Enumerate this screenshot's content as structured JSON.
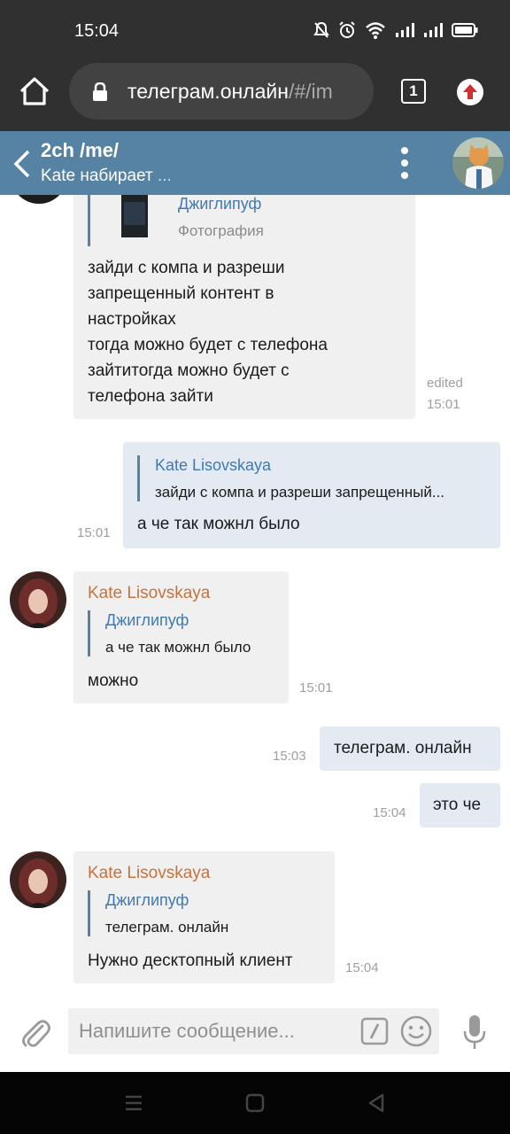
{
  "status_bar": {
    "time": "15:04",
    "icons": [
      "mute-icon",
      "alarm-icon",
      "wifi-icon",
      "signal-icon",
      "signal-icon",
      "battery-icon"
    ]
  },
  "browser": {
    "url_main": "телеграм.онлайн",
    "url_rest": "/#/im",
    "tab_count": "1"
  },
  "chat": {
    "title": "2ch /me/",
    "status": "Kate набирает",
    "status_dots": "..."
  },
  "messages": [
    {
      "direction": "incoming",
      "reply_name": "Джиглипуф",
      "reply_text": "Фотография",
      "lines": [
        "зайди с компа и разреши",
        "запрещенный контент в",
        "настройках",
        "тогда можно будет с телефона",
        "зайтитогда можно будет с",
        "телефона зайти"
      ],
      "edited": "edited",
      "time": "15:01"
    },
    {
      "direction": "outgoing",
      "reply_name": "Kate Lisovskaya",
      "reply_text": "зайди с компа и разреши запрещенный...",
      "text": "а че так можнл было",
      "time": "15:01"
    },
    {
      "direction": "incoming",
      "sender": "Kate Lisovskaya",
      "reply_name": "Джиглипуф",
      "reply_text": "а че так можнл было",
      "text": "можно",
      "time": "15:01"
    },
    {
      "direction": "outgoing",
      "text": "телеграм. онлайн",
      "time": "15:03"
    },
    {
      "direction": "outgoing",
      "text": "это че",
      "time": "15:04"
    },
    {
      "direction": "incoming",
      "sender": "Kate Lisovskaya",
      "reply_name": "Джиглипуф",
      "reply_text": "телеграм. онлайн",
      "text": "Нужно десктопный клиент",
      "time": "15:04"
    }
  ],
  "composer": {
    "placeholder": "Напишите сообщение..."
  },
  "colors": {
    "header": "#5682a3",
    "incoming_bubble": "#f0f0f0",
    "outgoing_bubble": "#e3eaf2",
    "sender_name": "#c8723a",
    "reply_name": "#3f7ab5"
  }
}
